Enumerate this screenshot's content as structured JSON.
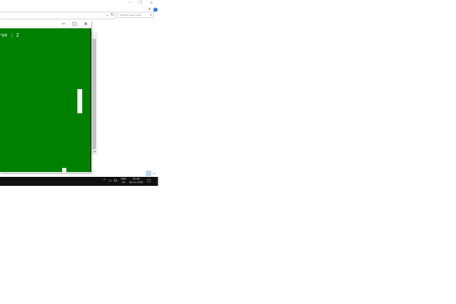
{
  "browser": {
    "search_placeholder": "Search Lock Grab",
    "controls": {
      "minimize": "─",
      "restore": "❐",
      "close": "✕"
    },
    "extras": {
      "dropdown": "⌄",
      "refresh": "↻",
      "info": "i",
      "close": "✕"
    }
  },
  "game_window": {
    "controls": {
      "minimize": "─",
      "maximize": "☐",
      "close": "✕"
    },
    "score_text": "ron : 2"
  },
  "taskbar": {
    "lang_top": "ENG",
    "lang_bottom": "IN",
    "time": "20:09",
    "date": "26-11-2020",
    "tray": {
      "chevron": "^",
      "battery": "▭",
      "network": "☊",
      "notification": "☐"
    }
  },
  "colors": {
    "game_background": "#008000",
    "paddle": "#ffffff",
    "ball": "#ffffff",
    "taskbar": "#101010",
    "info_badge": "#1a73e8"
  }
}
